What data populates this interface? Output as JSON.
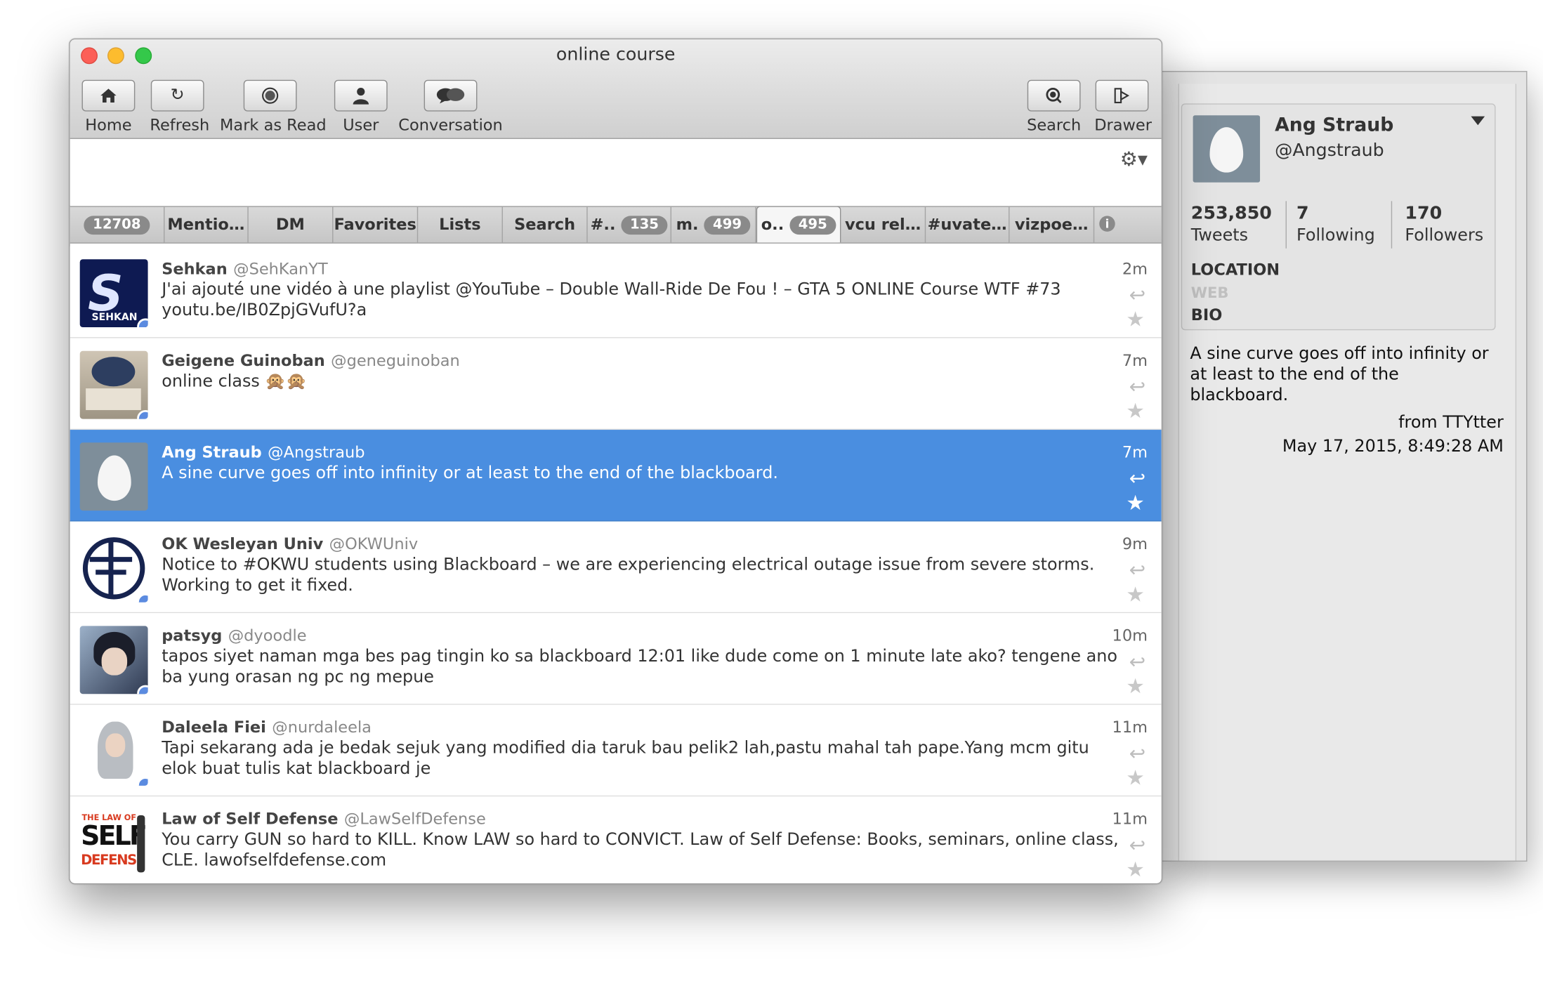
{
  "window": {
    "title": "online course"
  },
  "toolbar": {
    "home": "Home",
    "refresh": "Refresh",
    "mark_as_read": "Mark as Read",
    "user": "User",
    "conversation": "Conversation",
    "search": "Search",
    "drawer": "Drawer"
  },
  "tabs": [
    {
      "label": "",
      "badge": "12708"
    },
    {
      "label": "Mentio…",
      "badge": ""
    },
    {
      "label": "DM",
      "badge": ""
    },
    {
      "label": "Favorites",
      "badge": ""
    },
    {
      "label": "Lists",
      "badge": ""
    },
    {
      "label": "Search",
      "badge": ""
    },
    {
      "label": "#..",
      "badge": "135"
    },
    {
      "label": "m.",
      "badge": "499"
    },
    {
      "label": "o..",
      "badge": "495"
    },
    {
      "label": "vcu rel…",
      "badge": ""
    },
    {
      "label": "#uvate…",
      "badge": ""
    },
    {
      "label": "vizpoe…",
      "badge": ""
    }
  ],
  "tweets": [
    {
      "name": "Sehkan",
      "handle": "@SehKanYT",
      "text": "J'ai ajouté une vidéo à une playlist @YouTube – Double Wall-Ride De Fou ! – GTA 5 ONLINE Course WTF #73 youtu.be/IB0ZpjGVufU?a",
      "time": "2m",
      "avatar_text": "S",
      "avatar_caption": "SEHKAN"
    },
    {
      "name": "Geigene Guinoban",
      "handle": "@geneguinoban",
      "text": "online class 🙊🙊",
      "time": "7m"
    },
    {
      "name": "Ang Straub",
      "handle": "@Angstraub",
      "text": "A sine curve goes off into infinity or at least to the end of the blackboard.",
      "time": "7m"
    },
    {
      "name": "OK Wesleyan Univ",
      "handle": "@OKWUniv",
      "text": "Notice to #OKWU students using Blackboard – we are experiencing electrical outage issue from severe storms. Working to get it fixed.",
      "time": "9m"
    },
    {
      "name": "patsyg",
      "handle": "@dyoodle",
      "text": "tapos siyet naman mga bes pag tingin ko sa blackboard 12:01 like dude come on 1 minute late ako? tengene ano ba yung orasan ng pc ng mepue",
      "time": "10m"
    },
    {
      "name": "Daleela Fiei",
      "handle": "@nurdaleela",
      "text": "Tapi sekarang ada je bedak sejuk yang modified dia taruk bau pelik2 lah,pastu mahal tah pape.Yang mcm gitu elok buat tulis kat blackboard je",
      "time": "11m"
    },
    {
      "name": "Law of Self Defense",
      "handle": "@LawSelfDefense",
      "text": "You carry GUN so hard to KILL. Know LAW so hard to CONVICT. Law of Self Defense: Books, seminars, online class, CLE. lawofselfdefense.com",
      "time": "11m",
      "avatar_line1": "THE LAW OF",
      "avatar_line2": "SELF",
      "avatar_line3": "DEFENSE"
    }
  ],
  "drawer": {
    "name": "Ang Straub",
    "handle": "@Angstraub",
    "tweets_count": "253,850",
    "tweets_label": "Tweets",
    "following_count": "7",
    "following_label": "Following",
    "followers_count": "170",
    "followers_label": "Followers",
    "location_label": "LOCATION",
    "web_label": "WEB",
    "bio_label": "BIO",
    "tweet_text": "A sine curve goes off into infinity or at least to the end of the blackboard.",
    "from": "from TTYtter",
    "date": "May 17, 2015, 8:49:28 AM"
  },
  "colors": {
    "selection": "#4a8ee0",
    "badge": "#8a8a8a",
    "unread_dot": "#5b8be0"
  }
}
